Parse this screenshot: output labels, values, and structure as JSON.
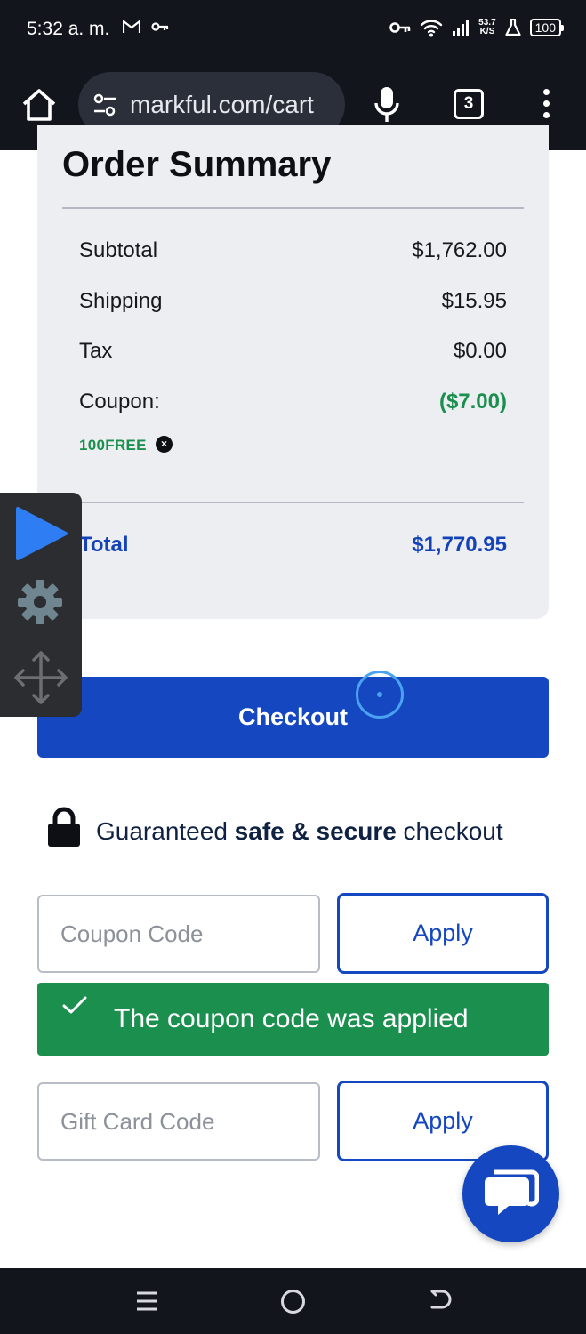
{
  "status_bar": {
    "time": "5:32 a. m.",
    "net_speed_value": "53.7",
    "net_speed_unit": "K/S",
    "battery": "100",
    "icons": [
      "gmail-icon",
      "key-icon",
      "key-icon",
      "wifi-icon",
      "signal-icon",
      "flask-icon",
      "battery-icon"
    ]
  },
  "browser": {
    "url": "markful.com/cart",
    "tab_count": "3"
  },
  "order_summary": {
    "title": "Order Summary",
    "subtotal_label": "Subtotal",
    "subtotal_value": "$1,762.00",
    "shipping_label": "Shipping",
    "shipping_value": "$15.95",
    "tax_label": "Tax",
    "tax_value": "$0.00",
    "coupon_label": "Coupon:",
    "coupon_value": "($7.00)",
    "coupon_code": "100FREE",
    "coupon_remove": "×",
    "total_label": "Total",
    "total_value": "$1,770.95"
  },
  "checkout": {
    "button_label": "Checkout"
  },
  "secure": {
    "text_before": "Guaranteed ",
    "text_bold": "safe & secure",
    "text_after": " checkout"
  },
  "coupon_form": {
    "placeholder": "Coupon Code",
    "apply_label": "Apply",
    "success_message": "The coupon code was applied"
  },
  "gift_card_form": {
    "placeholder": "Gift Card Code",
    "apply_label": "Apply"
  },
  "colors": {
    "primary": "#1547c0",
    "success": "#1a8f4e",
    "card_bg": "#eceef2",
    "system_bar": "#12151c"
  }
}
